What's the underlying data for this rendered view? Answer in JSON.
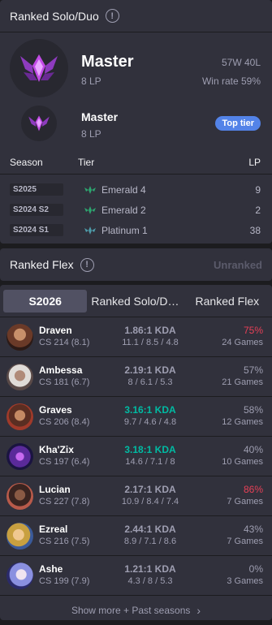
{
  "solo": {
    "title": "Ranked Solo/Duo",
    "tier": "Master",
    "lp": "8 LP",
    "record": "57W 40L",
    "winrate": "Win rate 59%",
    "peak_tier": "Master",
    "peak_lp": "8 LP",
    "peak_badge": "Top tier",
    "col_season": "Season",
    "col_tier": "Tier",
    "col_lp": "LP",
    "seasons": [
      {
        "season": "S2025",
        "tier": "Emerald 4",
        "lp": "9",
        "color": "#2ea36f"
      },
      {
        "season": "S2024 S2",
        "tier": "Emerald 2",
        "lp": "2",
        "color": "#2ea36f"
      },
      {
        "season": "S2024 S1",
        "tier": "Platinum 1",
        "lp": "38",
        "color": "#4e9aa8"
      }
    ]
  },
  "flex": {
    "title": "Ranked Flex",
    "status": "Unranked"
  },
  "champions": {
    "tabs": [
      "S2026",
      "Ranked Solo/D…",
      "Ranked Flex"
    ],
    "rows": [
      {
        "name": "Draven",
        "cs": "CS 214 (8.1)",
        "kda": "1.86:1 KDA",
        "kda_detail": "11.1 / 8.5 / 4.8",
        "winrate": "75%",
        "games": "24 Games"
      },
      {
        "name": "Ambessa",
        "cs": "CS 181 (6.7)",
        "kda": "2.19:1 KDA",
        "kda_detail": "8 / 6.1 / 5.3",
        "winrate": "57%",
        "games": "21 Games"
      },
      {
        "name": "Graves",
        "cs": "CS 206 (8.4)",
        "kda": "3.16:1 KDA",
        "kda_detail": "9.7 / 4.6 / 4.8",
        "winrate": "58%",
        "games": "12 Games"
      },
      {
        "name": "Kha'Zix",
        "cs": "CS 197 (6.4)",
        "kda": "3.18:1 KDA",
        "kda_detail": "14.6 / 7.1 / 8",
        "winrate": "40%",
        "games": "10 Games"
      },
      {
        "name": "Lucian",
        "cs": "CS 227 (7.8)",
        "kda": "2.17:1 KDA",
        "kda_detail": "10.9 / 8.4 / 7.4",
        "winrate": "86%",
        "games": "7 Games"
      },
      {
        "name": "Ezreal",
        "cs": "CS 216 (7.5)",
        "kda": "2.44:1 KDA",
        "kda_detail": "8.9 / 7.1 / 8.6",
        "winrate": "43%",
        "games": "7 Games"
      },
      {
        "name": "Ashe",
        "cs": "CS 199 (7.9)",
        "kda": "1.21:1 KDA",
        "kda_detail": "4.3 / 8 / 5.3",
        "winrate": "0%",
        "games": "3 Games"
      }
    ],
    "show_more": "Show more + Past seasons"
  },
  "colors": {
    "card": "#31313c",
    "background": "#1c1c1f",
    "accent_blue": "#5383e8",
    "kda_good": "#00bba3",
    "winrate_hot": "#e84057",
    "master_purple": "#9d48e0"
  }
}
